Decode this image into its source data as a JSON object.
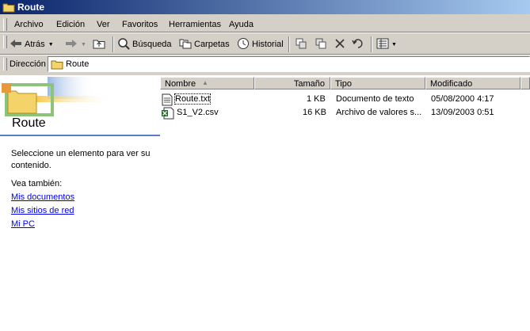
{
  "window": {
    "title": "Route",
    "icon": "folder-icon"
  },
  "menubar": {
    "items": [
      {
        "label": "Archivo"
      },
      {
        "label": "Edición"
      },
      {
        "label": "Ver"
      },
      {
        "label": "Favoritos"
      },
      {
        "label": "Herramientas"
      },
      {
        "label": "Ayuda"
      }
    ]
  },
  "toolbar": {
    "back_label": "Atrás",
    "search_label": "Búsqueda",
    "folders_label": "Carpetas",
    "history_label": "Historial"
  },
  "addressbar": {
    "label": "Dirección",
    "value": "Route"
  },
  "leftpane": {
    "title": "Route",
    "info": "Seleccione un elemento para ver su contenido.",
    "see_also": "Vea también:",
    "links": [
      "Mis documentos",
      "Mis sitios de red",
      "Mi PC"
    ]
  },
  "filelist": {
    "columns": {
      "name": "Nombre",
      "size": "Tamaño",
      "type": "Tipo",
      "modified": "Modificado"
    },
    "sort_column": "Nombre",
    "rows": [
      {
        "name": "Route.txt",
        "size": "1 KB",
        "type": "Documento de texto",
        "modified": "05/08/2000 4:17",
        "icon": "text-file-icon"
      },
      {
        "name": "S1_V2.csv",
        "size": "16 KB",
        "type": "Archivo de valores s...",
        "modified": "13/09/2003 0:51",
        "icon": "csv-file-icon"
      }
    ]
  }
}
